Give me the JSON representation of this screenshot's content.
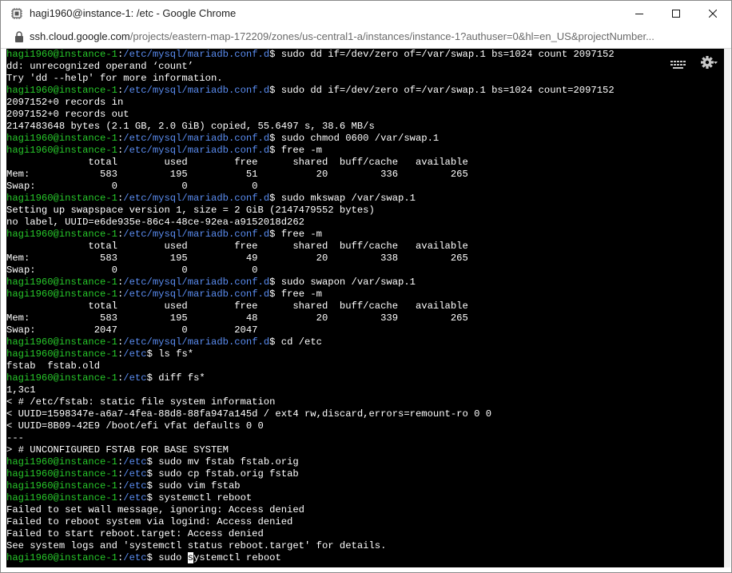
{
  "window": {
    "title": "hagi1960@instance-1: /etc - Google Chrome",
    "controls": [
      "minimize",
      "maximize",
      "close"
    ]
  },
  "address": {
    "host": "ssh.cloud.google.com",
    "path": "/projects/eastern-map-172209/zones/us-central1-a/instances/instance-1?authuser=0&hl=en_US&projectNumber..."
  },
  "terminal": {
    "toolbar_icons": [
      "keyboard-icon",
      "gear-icon"
    ],
    "colors": {
      "user": "#27c72a",
      "path": "#5a8cf0",
      "text": "#ffffff",
      "background": "#000000"
    },
    "lines": [
      {
        "p": {
          "user": "hagi1960@instance-1",
          "path": "/etc/mysql/mariadb.conf.d"
        },
        "cmd": "sudo dd if=/dev/zero of=/var/swap.1 bs=1024 count 2097152"
      },
      {
        "text": "dd: unrecognized operand ‘count’"
      },
      {
        "text": "Try 'dd --help' for more information."
      },
      {
        "p": {
          "user": "hagi1960@instance-1",
          "path": "/etc/mysql/mariadb.conf.d"
        },
        "cmd": "sudo dd if=/dev/zero of=/var/swap.1 bs=1024 count=2097152"
      },
      {
        "text": "2097152+0 records in"
      },
      {
        "text": "2097152+0 records out"
      },
      {
        "text": "2147483648 bytes (2.1 GB, 2.0 GiB) copied, 55.6497 s, 38.6 MB/s"
      },
      {
        "p": {
          "user": "hagi1960@instance-1",
          "path": "/etc/mysql/mariadb.conf.d"
        },
        "cmd": "sudo chmod 0600 /var/swap.1"
      },
      {
        "p": {
          "user": "hagi1960@instance-1",
          "path": "/etc/mysql/mariadb.conf.d"
        },
        "cmd": "free -m"
      },
      {
        "text": "              total        used        free      shared  buff/cache   available"
      },
      {
        "text": "Mem:            583         195          51          20         336         265"
      },
      {
        "text": "Swap:             0           0           0"
      },
      {
        "p": {
          "user": "hagi1960@instance-1",
          "path": "/etc/mysql/mariadb.conf.d"
        },
        "cmd": "sudo mkswap /var/swap.1"
      },
      {
        "text": "Setting up swapspace version 1, size = 2 GiB (2147479552 bytes)"
      },
      {
        "text": "no label, UUID=e6de935e-86c4-48ce-92ea-a9152018d262"
      },
      {
        "p": {
          "user": "hagi1960@instance-1",
          "path": "/etc/mysql/mariadb.conf.d"
        },
        "cmd": "free -m"
      },
      {
        "text": "              total        used        free      shared  buff/cache   available"
      },
      {
        "text": "Mem:            583         195          49          20         338         265"
      },
      {
        "text": "Swap:             0           0           0"
      },
      {
        "p": {
          "user": "hagi1960@instance-1",
          "path": "/etc/mysql/mariadb.conf.d"
        },
        "cmd": "sudo swapon /var/swap.1"
      },
      {
        "p": {
          "user": "hagi1960@instance-1",
          "path": "/etc/mysql/mariadb.conf.d"
        },
        "cmd": "free -m"
      },
      {
        "text": "              total        used        free      shared  buff/cache   available"
      },
      {
        "text": "Mem:            583         195          48          20         339         265"
      },
      {
        "text": "Swap:          2047           0        2047"
      },
      {
        "p": {
          "user": "hagi1960@instance-1",
          "path": "/etc/mysql/mariadb.conf.d"
        },
        "cmd": "cd /etc"
      },
      {
        "p": {
          "user": "hagi1960@instance-1",
          "path": "/etc"
        },
        "cmd": "ls fs*"
      },
      {
        "text": "fstab  fstab.old"
      },
      {
        "p": {
          "user": "hagi1960@instance-1",
          "path": "/etc"
        },
        "cmd": "diff fs*"
      },
      {
        "text": "1,3c1"
      },
      {
        "text": "< # /etc/fstab: static file system information"
      },
      {
        "text": "< UUID=1598347e-a6a7-4fea-88d8-88fa947a145d / ext4 rw,discard,errors=remount-ro 0 0"
      },
      {
        "text": "< UUID=8B09-42E9 /boot/efi vfat defaults 0 0"
      },
      {
        "text": "---"
      },
      {
        "text": "> # UNCONFIGURED FSTAB FOR BASE SYSTEM"
      },
      {
        "p": {
          "user": "hagi1960@instance-1",
          "path": "/etc"
        },
        "cmd": "sudo mv fstab fstab.orig"
      },
      {
        "p": {
          "user": "hagi1960@instance-1",
          "path": "/etc"
        },
        "cmd": "sudo cp fstab.orig fstab"
      },
      {
        "p": {
          "user": "hagi1960@instance-1",
          "path": "/etc"
        },
        "cmd": "sudo vim fstab"
      },
      {
        "p": {
          "user": "hagi1960@instance-1",
          "path": "/etc"
        },
        "cmd": "systemctl reboot"
      },
      {
        "text": "Failed to set wall message, ignoring: Access denied"
      },
      {
        "text": "Failed to reboot system via logind: Access denied"
      },
      {
        "text": "Failed to start reboot.target: Access denied"
      },
      {
        "text": "See system logs and 'systemctl status reboot.target' for details."
      },
      {
        "p": {
          "user": "hagi1960@instance-1",
          "path": "/etc"
        },
        "cmd_before": "sudo ",
        "cursor": "s",
        "cmd_after": "ystemctl reboot"
      }
    ]
  }
}
